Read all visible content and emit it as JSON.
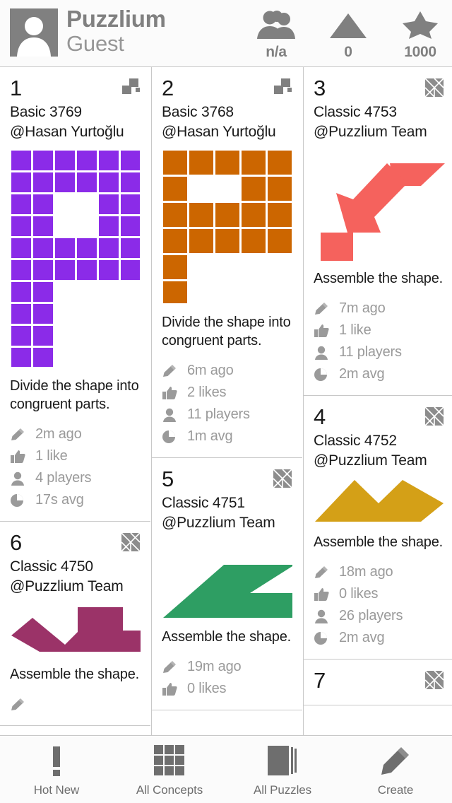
{
  "header": {
    "avatar_icon": "person-avatar-icon",
    "brand_line1": "Puzzlium",
    "brand_line2": "Guest",
    "stats": [
      {
        "icon": "people-group-icon",
        "value": "n/a"
      },
      {
        "icon": "triangle-up-icon",
        "value": "0"
      },
      {
        "icon": "star-icon",
        "value": "1000"
      }
    ]
  },
  "colors": {
    "purple": "#8B2BE8",
    "orange": "#CC6600",
    "red": "#F5625D",
    "gold": "#D4A017",
    "green": "#2E9E63",
    "magenta": "#9B3368",
    "gray_icon": "#808080",
    "meta_text": "#9a9a9a",
    "divider": "#c8c8c8"
  },
  "cards": [
    {
      "rank": "1",
      "title": "Basic 3769",
      "author": "@Hasan Yurtoğlu",
      "type_icon": "basic-blocks-icon",
      "shape": "purple-letter-p",
      "desc": "Divide the shape into congruent parts.",
      "meta": [
        {
          "icon": "pencil-icon",
          "text": "2m ago"
        },
        {
          "icon": "thumbs-up-icon",
          "text": "1 like"
        },
        {
          "icon": "person-icon",
          "text": "4 players"
        },
        {
          "icon": "pie-clock-icon",
          "text": "17s avg"
        }
      ]
    },
    {
      "rank": "2",
      "title": "Basic 3768",
      "author": "@Hasan Yurtoğlu",
      "type_icon": "basic-blocks-icon",
      "shape": "orange-letter-p",
      "desc": "Divide the shape into congruent parts.",
      "meta": [
        {
          "icon": "pencil-icon",
          "text": "6m ago"
        },
        {
          "icon": "thumbs-up-icon",
          "text": "2 likes"
        },
        {
          "icon": "person-icon",
          "text": "11 players"
        },
        {
          "icon": "pie-clock-icon",
          "text": "1m avg"
        }
      ]
    },
    {
      "rank": "3",
      "title": "Classic 4753",
      "author": "@Puzzlium Team",
      "type_icon": "classic-tangram-icon",
      "shape": "red-arrow",
      "desc": "Assemble the shape.",
      "meta": [
        {
          "icon": "pencil-icon",
          "text": "7m ago"
        },
        {
          "icon": "thumbs-up-icon",
          "text": "1 like"
        },
        {
          "icon": "person-icon",
          "text": "11 players"
        },
        {
          "icon": "pie-clock-icon",
          "text": "2m avg"
        }
      ]
    },
    {
      "rank": "4",
      "title": "Classic 4752",
      "author": "@Puzzlium Team",
      "type_icon": "classic-tangram-icon",
      "shape": "gold-mountains",
      "desc": "Assemble the shape.",
      "meta": [
        {
          "icon": "pencil-icon",
          "text": "18m ago"
        },
        {
          "icon": "thumbs-up-icon",
          "text": "0 likes"
        },
        {
          "icon": "person-icon",
          "text": "26 players"
        },
        {
          "icon": "pie-clock-icon",
          "text": "2m avg"
        }
      ]
    },
    {
      "rank": "5",
      "title": "Classic 4751",
      "author": "@Puzzlium Team",
      "type_icon": "classic-tangram-icon",
      "shape": "green-triangle",
      "desc": "Assemble the shape.",
      "meta": [
        {
          "icon": "pencil-icon",
          "text": "19m ago"
        },
        {
          "icon": "thumbs-up-icon",
          "text": "0 likes"
        }
      ]
    },
    {
      "rank": "6",
      "title": "Classic 4750",
      "author": "@Puzzlium Team",
      "type_icon": "classic-tangram-icon",
      "shape": "magenta-boot",
      "desc": "Assemble the shape.",
      "meta": []
    },
    {
      "rank": "7",
      "title": "",
      "author": "",
      "type_icon": "classic-tangram-icon",
      "shape": "",
      "desc": "",
      "meta": []
    }
  ],
  "nav": [
    {
      "icon": "exclamation-icon",
      "label": "Hot New"
    },
    {
      "icon": "grid-icon",
      "label": "All Concepts"
    },
    {
      "icon": "pages-icon",
      "label": "All Puzzles"
    },
    {
      "icon": "pencil-icon",
      "label": "Create"
    }
  ]
}
